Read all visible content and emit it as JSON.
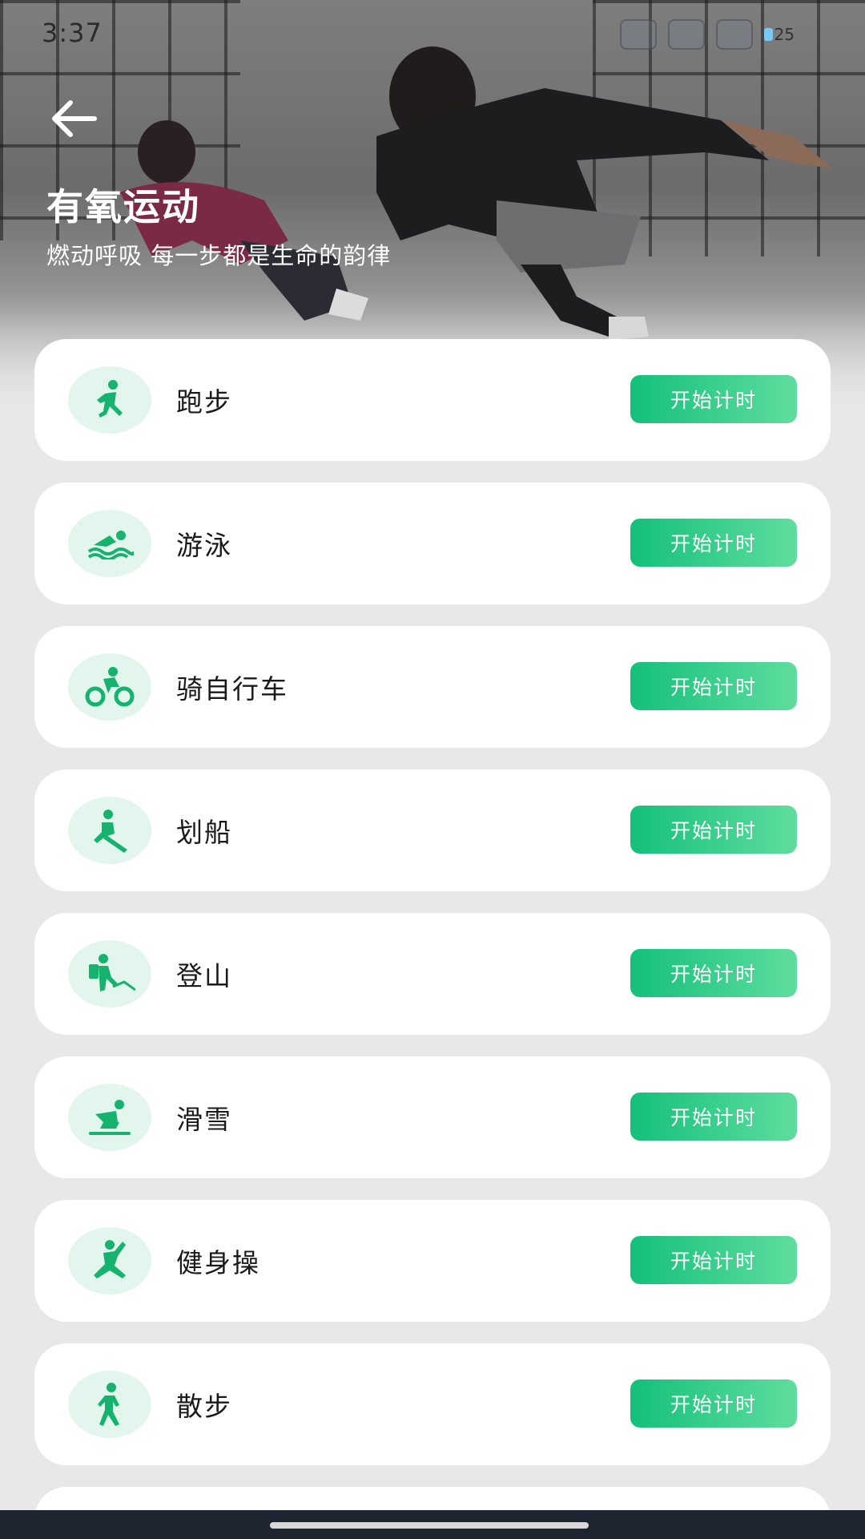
{
  "status_bar": {
    "time": "3:37",
    "battery_level": "25",
    "app_icons": [
      "app-notification-icon",
      "app-notification-icon",
      "app-notification-icon"
    ]
  },
  "header": {
    "back_icon": "arrow-left-icon",
    "title": "有氧运动",
    "subtitle": "燃动呼吸 每一步都是生命的韵律"
  },
  "colors": {
    "accent": "#14C07A",
    "accent_light": "#5FDD9E",
    "icon_bg": "#E3F6EE",
    "page_bg": "#E8E8E8"
  },
  "activities": [
    {
      "label": "跑步",
      "icon": "running-icon",
      "button": "开始计时"
    },
    {
      "label": "游泳",
      "icon": "swimming-icon",
      "button": "开始计时"
    },
    {
      "label": "骑自行车",
      "icon": "cycling-icon",
      "button": "开始计时"
    },
    {
      "label": "划船",
      "icon": "rowing-icon",
      "button": "开始计时"
    },
    {
      "label": "登山",
      "icon": "hiking-icon",
      "button": "开始计时"
    },
    {
      "label": "滑雪",
      "icon": "skiing-icon",
      "button": "开始计时"
    },
    {
      "label": "健身操",
      "icon": "aerobics-icon",
      "button": "开始计时"
    },
    {
      "label": "散步",
      "icon": "walking-icon",
      "button": "开始计时"
    }
  ]
}
